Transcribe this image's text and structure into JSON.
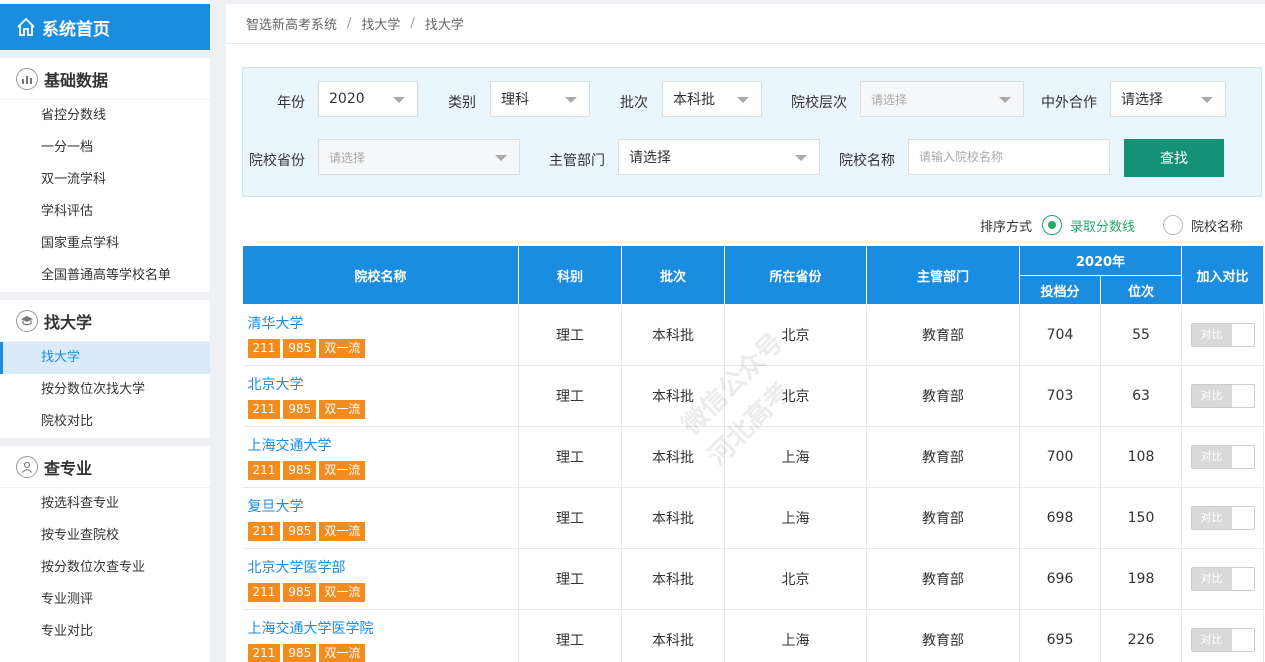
{
  "sidebar": {
    "home_label": "系统首页",
    "sections": [
      {
        "title": "基础数据",
        "icon": "bar-chart-icon",
        "items": [
          "省控分数线",
          "一分一档",
          "双一流学科",
          "学科评估",
          "国家重点学科",
          "全国普通高等学校名单"
        ]
      },
      {
        "title": "找大学",
        "icon": "graduation-cap-icon",
        "items": [
          "找大学",
          "按分数位次找大学",
          "院校对比"
        ]
      },
      {
        "title": "查专业",
        "icon": "user-icon",
        "items": [
          "按选科查专业",
          "按专业查院校",
          "按分数位次查专业",
          "专业测评",
          "专业对比"
        ]
      }
    ],
    "active_item": "找大学"
  },
  "breadcrumb": [
    "智选新高考系统",
    "找大学",
    "找大学"
  ],
  "filters": {
    "year": {
      "label": "年份",
      "value": "2020"
    },
    "category": {
      "label": "类别",
      "value": "理科"
    },
    "batch": {
      "label": "批次",
      "value": "本科批"
    },
    "school_level": {
      "label": "院校层次",
      "value": "请选择"
    },
    "joint": {
      "label": "中外合作",
      "value": "请选择"
    },
    "province": {
      "label": "院校省份",
      "value": "请选择"
    },
    "department": {
      "label": "主管部门",
      "value": "请选择"
    },
    "school_name": {
      "label": "院校名称",
      "placeholder": "请输入院校名称"
    },
    "search_button": "查找"
  },
  "sort": {
    "label": "排序方式",
    "options": [
      "录取分数线",
      "院校名称"
    ],
    "selected": "录取分数线"
  },
  "table": {
    "headers": {
      "name": "院校名称",
      "subject": "科别",
      "batch": "批次",
      "province": "所在省份",
      "department": "主管部门",
      "year_group": "2020年",
      "score": "投档分",
      "rank": "位次",
      "compare": "加入对比"
    },
    "compare_label": "对比",
    "rows": [
      {
        "name": "清华大学",
        "tags": [
          "211",
          "985",
          "双一流"
        ],
        "subject": "理工",
        "batch": "本科批",
        "province": "北京",
        "department": "教育部",
        "score": "704",
        "rank": "55"
      },
      {
        "name": "北京大学",
        "tags": [
          "211",
          "985",
          "双一流"
        ],
        "subject": "理工",
        "batch": "本科批",
        "province": "北京",
        "department": "教育部",
        "score": "703",
        "rank": "63"
      },
      {
        "name": "上海交通大学",
        "tags": [
          "211",
          "985",
          "双一流"
        ],
        "subject": "理工",
        "batch": "本科批",
        "province": "上海",
        "department": "教育部",
        "score": "700",
        "rank": "108"
      },
      {
        "name": "复旦大学",
        "tags": [
          "211",
          "985",
          "双一流"
        ],
        "subject": "理工",
        "batch": "本科批",
        "province": "上海",
        "department": "教育部",
        "score": "698",
        "rank": "150"
      },
      {
        "name": "北京大学医学部",
        "tags": [
          "211",
          "985",
          "双一流"
        ],
        "subject": "理工",
        "batch": "本科批",
        "province": "北京",
        "department": "教育部",
        "score": "696",
        "rank": "198"
      },
      {
        "name": "上海交通大学医学院",
        "tags": [
          "211",
          "985",
          "双一流"
        ],
        "subject": "理工",
        "batch": "本科批",
        "province": "上海",
        "department": "教育部",
        "score": "695",
        "rank": "226"
      }
    ]
  },
  "watermark": {
    "line1": "微信公众号",
    "line2": "河北高考"
  }
}
